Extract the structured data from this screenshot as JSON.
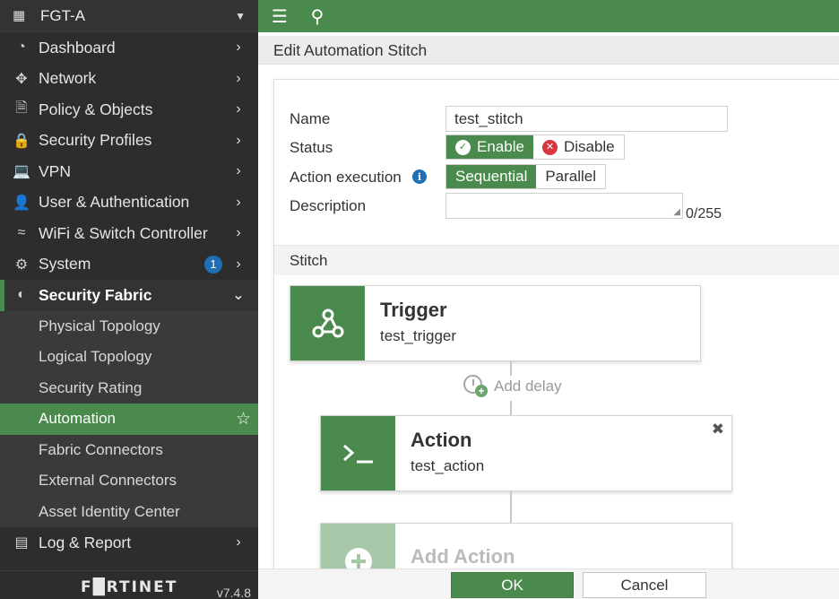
{
  "device": {
    "name": "FGT-A"
  },
  "sidebar": {
    "items": [
      {
        "label": "Dashboard",
        "icon": "dashboard-icon"
      },
      {
        "label": "Network",
        "icon": "network-icon"
      },
      {
        "label": "Policy & Objects",
        "icon": "policy-icon"
      },
      {
        "label": "Security Profiles",
        "icon": "lock-icon"
      },
      {
        "label": "VPN",
        "icon": "laptop-icon"
      },
      {
        "label": "User & Authentication",
        "icon": "user-icon"
      },
      {
        "label": "WiFi & Switch Controller",
        "icon": "wifi-icon"
      },
      {
        "label": "System",
        "icon": "gear-icon",
        "badge": "1"
      },
      {
        "label": "Security Fabric",
        "icon": "fabric-icon"
      }
    ],
    "fabric_sub": [
      "Physical Topology",
      "Logical Topology",
      "Security Rating",
      "Automation",
      "Fabric Connectors",
      "External Connectors",
      "Asset Identity Center"
    ],
    "log_report": "Log & Report",
    "brand": "F█RTINET",
    "version": "v7.4.8"
  },
  "page": {
    "title": "Edit Automation Stitch"
  },
  "form": {
    "name_label": "Name",
    "name_value": "test_stitch",
    "status_label": "Status",
    "status_enable": "Enable",
    "status_disable": "Disable",
    "action_exec_label": "Action execution",
    "exec_sequential": "Sequential",
    "exec_parallel": "Parallel",
    "description_label": "Description",
    "description_value": "",
    "description_count": "0/255"
  },
  "stitch": {
    "header": "Stitch",
    "trigger_title": "Trigger",
    "trigger_name": "test_trigger",
    "add_delay": "Add delay",
    "action_title": "Action",
    "action_name": "test_action",
    "add_action": "Add Action"
  },
  "buttons": {
    "ok": "OK",
    "cancel": "Cancel"
  },
  "colors": {
    "accent": "#4a8a4c",
    "sidebar_bg": "#2d2d2d",
    "badge": "#1f6fb5",
    "danger": "#d9363e"
  }
}
